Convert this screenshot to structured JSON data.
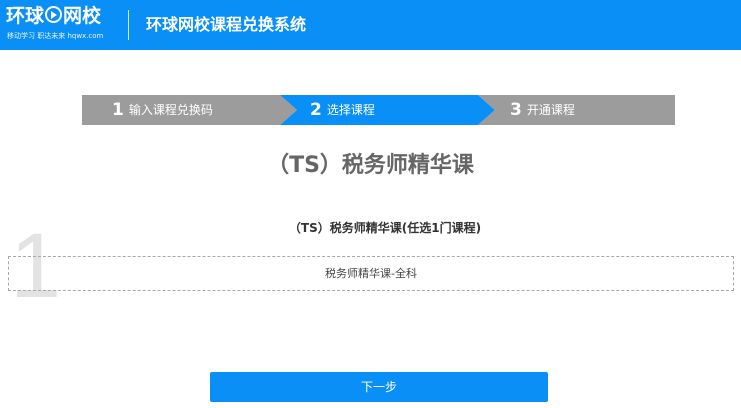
{
  "header": {
    "logo_text_1": "环球",
    "logo_text_2": "网校",
    "logo_slogan": "移动学习 职达未来 hqwx.com",
    "title": "环球网校课程兑换系统"
  },
  "steps": [
    {
      "number": "1",
      "label": "输入课程兑换码",
      "state": "done"
    },
    {
      "number": "2",
      "label": "选择课程",
      "state": "active"
    },
    {
      "number": "3",
      "label": "开通课程",
      "state": "pending"
    }
  ],
  "course": {
    "title": "（TS）税务师精华课",
    "group_index": "1",
    "group_title": "（TS）税务师精华课(任选1门课程)",
    "options": [
      "税务师精华课-全科"
    ]
  },
  "next_button_label": "下一步",
  "colors": {
    "brand_blue": "#0a8ff7",
    "step_inactive": "#9c9c9c"
  }
}
